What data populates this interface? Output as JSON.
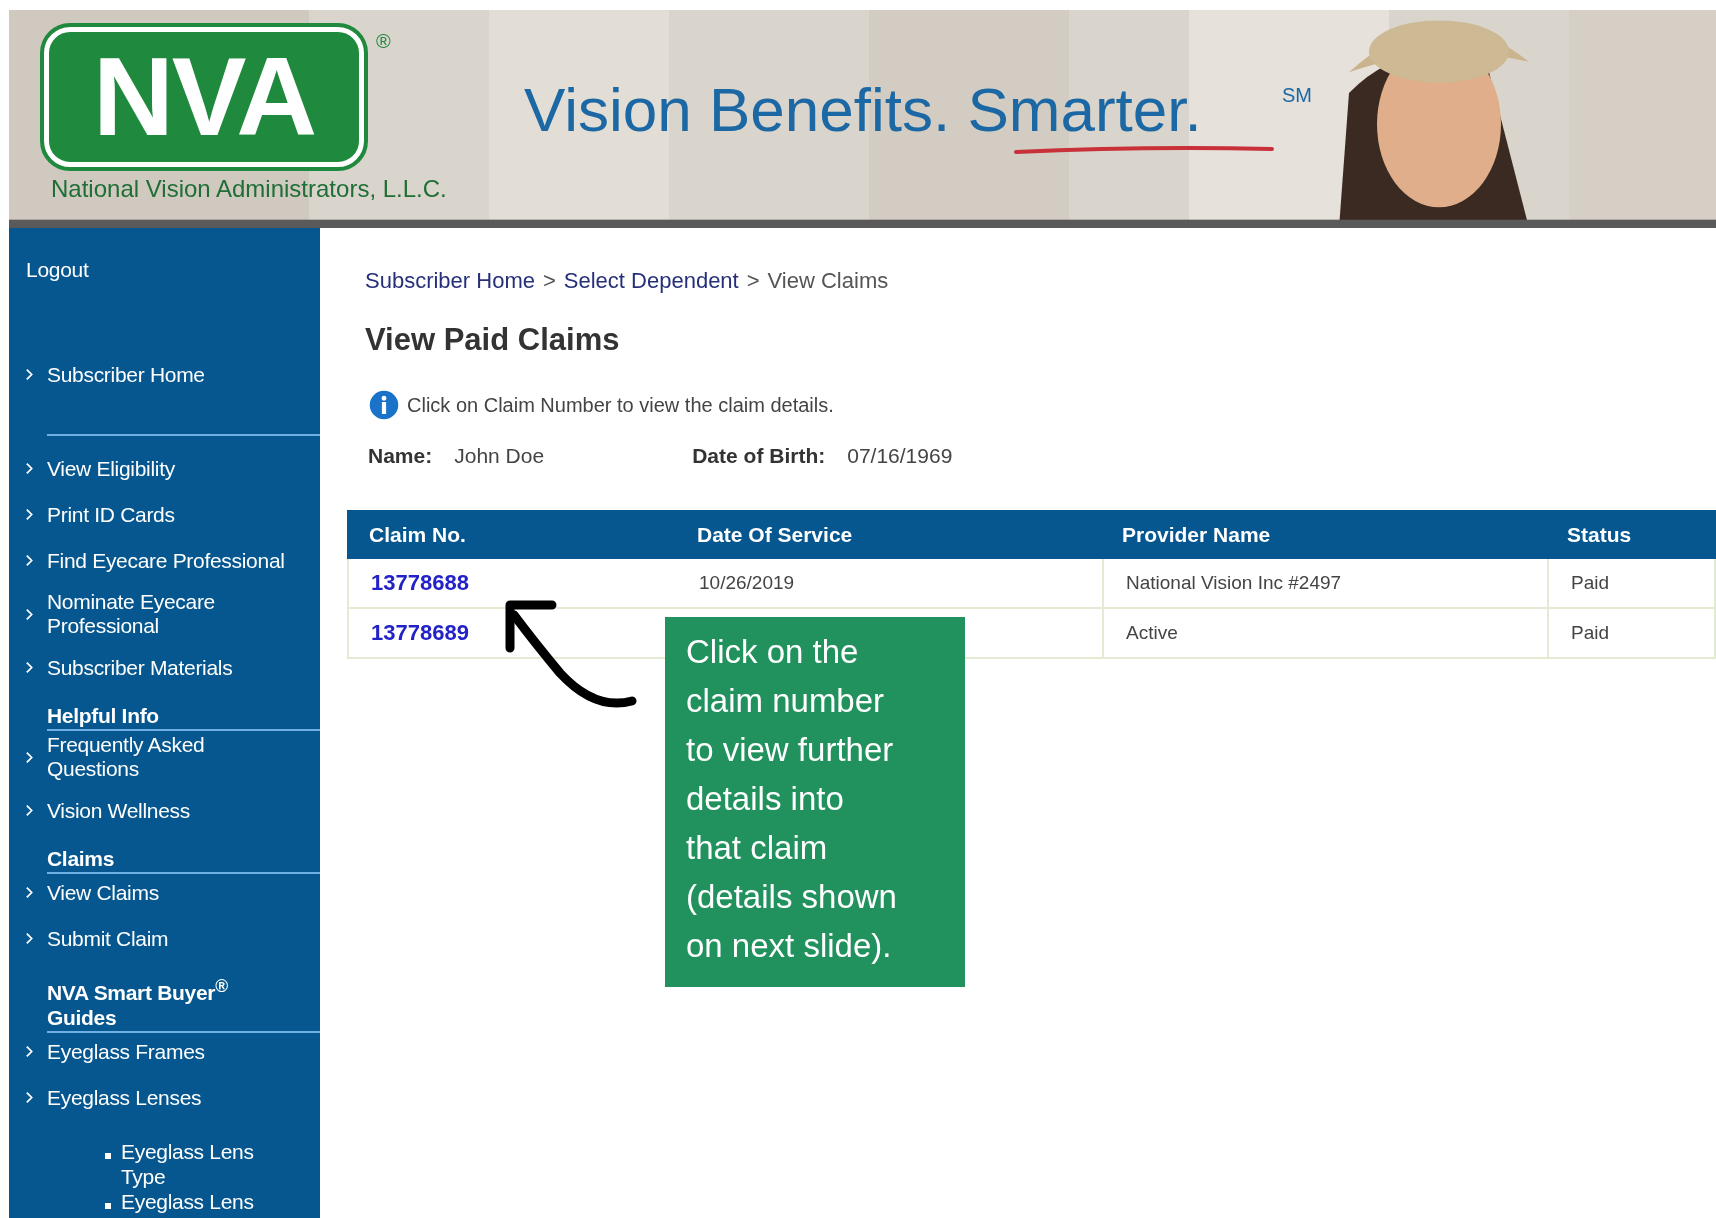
{
  "banner": {
    "logo": "NVA",
    "logo_mark": "®",
    "company": "National Vision Administrators, L.L.C.",
    "slogan": "Vision Benefits. Smarter.",
    "slogan_mark": "SM"
  },
  "sidebar": {
    "items": [
      {
        "label": "Logout",
        "kind": "plain"
      },
      {
        "label": "Subscriber Home",
        "kind": "link"
      },
      {
        "label": "View Eligibility",
        "kind": "link",
        "rule_above": true
      },
      {
        "label": "Print ID Cards",
        "kind": "link"
      },
      {
        "label": "Find Eyecare Professional",
        "kind": "link"
      },
      {
        "label": "Nominate Eyecare\nProfessional",
        "kind": "link"
      },
      {
        "label": "Subscriber Materials",
        "kind": "link"
      },
      {
        "label": "Helpful Info",
        "kind": "heading"
      },
      {
        "label": "Frequently Asked\nQuestions",
        "kind": "link"
      },
      {
        "label": "Vision Wellness",
        "kind": "link"
      },
      {
        "label": "Claims",
        "kind": "heading"
      },
      {
        "label": "View Claims",
        "kind": "link"
      },
      {
        "label": "Submit Claim",
        "kind": "link"
      },
      {
        "label": "NVA Smart Buyer$^{®}$\nGuides",
        "kind": "heading"
      },
      {
        "label": "Eyeglass Frames",
        "kind": "link"
      },
      {
        "label": "Eyeglass Lenses",
        "kind": "link"
      },
      {
        "label": "Eyeglass Lens Type",
        "kind": "bullet"
      },
      {
        "label": "Eyeglass Lens",
        "kind": "bullet"
      }
    ]
  },
  "breadcrumb": {
    "separator": ">",
    "items": [
      {
        "label": "Subscriber Home",
        "kind": "link"
      },
      {
        "label": "Select Dependent",
        "kind": "link"
      },
      {
        "label": "View Claims",
        "kind": "current"
      }
    ]
  },
  "title": "View Paid Claims",
  "info": "Click on Claim Number to view the claim details.",
  "member": {
    "name_label": "Name:",
    "name": "John Doe",
    "dob_label": "Date of Birth:",
    "dob": "07/16/1969"
  },
  "table": {
    "columns": [
      "Claim No.",
      "Date Of Service",
      "Provider Name",
      "Status"
    ],
    "rows": [
      {
        "claim": "13778688",
        "date": "10/26/2019",
        "provider": "National Vision Inc #2497",
        "status": "Paid"
      },
      {
        "claim": "13778689",
        "provider": "Active",
        "status": "Paid"
      }
    ]
  },
  "callout": [
    "Click on the",
    "claim number",
    "to view further",
    "details into",
    "that claim",
    "(details shown",
    "on next slide)."
  ]
}
